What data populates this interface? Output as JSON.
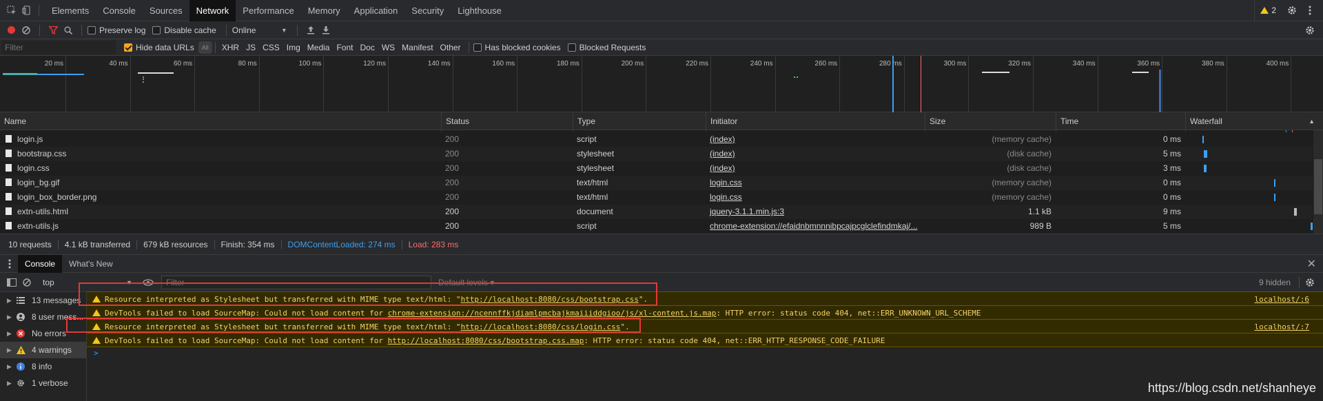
{
  "tabs": [
    {
      "label": "Elements"
    },
    {
      "label": "Console"
    },
    {
      "label": "Sources"
    },
    {
      "label": "Network",
      "active": true
    },
    {
      "label": "Performance"
    },
    {
      "label": "Memory"
    },
    {
      "label": "Application"
    },
    {
      "label": "Security"
    },
    {
      "label": "Lighthouse"
    }
  ],
  "warning_badge": "2",
  "toolbar": {
    "preserve_log": "Preserve log",
    "disable_cache": "Disable cache",
    "throttle": "Online"
  },
  "filter": {
    "placeholder": "Filter",
    "hide_data_urls": "Hide data URLs",
    "all": "All",
    "types": [
      "XHR",
      "JS",
      "CSS",
      "Img",
      "Media",
      "Font",
      "Doc",
      "WS",
      "Manifest",
      "Other"
    ],
    "blocked_cookies": "Has blocked cookies",
    "blocked_requests": "Blocked Requests"
  },
  "overview_ticks": [
    "20 ms",
    "40 ms",
    "60 ms",
    "80 ms",
    "100 ms",
    "120 ms",
    "140 ms",
    "160 ms",
    "180 ms",
    "200 ms",
    "220 ms",
    "240 ms",
    "260 ms",
    "280 ms",
    "300 ms",
    "320 ms",
    "340 ms",
    "360 ms",
    "380 ms",
    "400 ms"
  ],
  "columns": {
    "name": "Name",
    "status": "Status",
    "type": "Type",
    "initiator": "Initiator",
    "size": "Size",
    "time": "Time",
    "waterfall": "Waterfall"
  },
  "requests": [
    {
      "name": "login.js",
      "status": "200",
      "type": "script",
      "initiator": "(index)",
      "size": "(memory cache)",
      "time": "0 ms",
      "cached": true
    },
    {
      "name": "bootstrap.css",
      "status": "200",
      "type": "stylesheet",
      "initiator": "(index)",
      "size": "(disk cache)",
      "time": "5 ms",
      "cached": true
    },
    {
      "name": "login.css",
      "status": "200",
      "type": "stylesheet",
      "initiator": "(index)",
      "size": "(disk cache)",
      "time": "3 ms",
      "cached": true
    },
    {
      "name": "login_bg.gif",
      "status": "200",
      "type": "text/html",
      "initiator": "login.css",
      "size": "(memory cache)",
      "time": "0 ms",
      "cached": true
    },
    {
      "name": "login_box_border.png",
      "status": "200",
      "type": "text/html",
      "initiator": "login.css",
      "size": "(memory cache)",
      "time": "0 ms",
      "cached": true
    },
    {
      "name": "extn-utils.html",
      "status": "200",
      "type": "document",
      "initiator": "jquery-3.1.1.min.js:3",
      "size": "1.1 kB",
      "time": "9 ms",
      "cached": false
    },
    {
      "name": "extn-utils.js",
      "status": "200",
      "type": "script",
      "initiator": "chrome-extension://efaidnbmnnnibpcajpcglclefindmkaj/...",
      "size": "989 B",
      "time": "5 ms",
      "cached": false
    }
  ],
  "summary": {
    "requests": "10 requests",
    "transferred": "4.1 kB transferred",
    "resources": "679 kB resources",
    "finish": "Finish: 354 ms",
    "dcl": "DOMContentLoaded: 274 ms",
    "load": "Load: 283 ms"
  },
  "drawer_tabs": {
    "console": "Console",
    "whats_new": "What's New"
  },
  "console_toolbar": {
    "context": "top",
    "filter_placeholder": "Filter",
    "levels": "Default levels ▾",
    "hidden": "9 hidden"
  },
  "sidebar": [
    {
      "label": "13 messages",
      "icon": "list-icon"
    },
    {
      "label": "8 user mess...",
      "icon": "user-icon"
    },
    {
      "label": "No errors",
      "icon": "error-icon"
    },
    {
      "label": "4 warnings",
      "icon": "warning-icon",
      "selected": true
    },
    {
      "label": "8 info",
      "icon": "info-icon"
    },
    {
      "label": "1 verbose",
      "icon": "verbose-icon"
    }
  ],
  "messages": [
    {
      "prefix": "Resource interpreted as Stylesheet but transferred with MIME type text/html: \"",
      "link": "http://localhost:8080/css/bootstrap.css",
      "suffix": "\".",
      "source": "localhost/:6"
    },
    {
      "prefix": "DevTools failed to load SourceMap: Could not load content for ",
      "link": "chrome-extension://ncennffkjdiamlpmcbajkmaiiiddgioo/js/xl-content.js.map",
      "suffix": ": HTTP error: status code 404, net::ERR_UNKNOWN_URL_SCHEME",
      "source": ""
    },
    {
      "prefix": "Resource interpreted as Stylesheet but transferred with MIME type text/html: \"",
      "link": "http://localhost:8080/css/login.css",
      "suffix": "\".",
      "source": "localhost/:7"
    },
    {
      "prefix": "DevTools failed to load SourceMap: Could not load content for ",
      "link": "http://localhost:8080/css/bootstrap.css.map",
      "suffix": ": HTTP error: status code 404, net::ERR_HTTP_RESPONSE_CODE_FAILURE",
      "source": ""
    }
  ],
  "prompt": ">",
  "watermark": "https://blog.csdn.net/shanheye",
  "colors": {
    "dcl": "#3d9ff0",
    "load": "#ff6b6b",
    "warning": "#f5c518",
    "record": "#e53935",
    "filter_active": "#e53935"
  }
}
